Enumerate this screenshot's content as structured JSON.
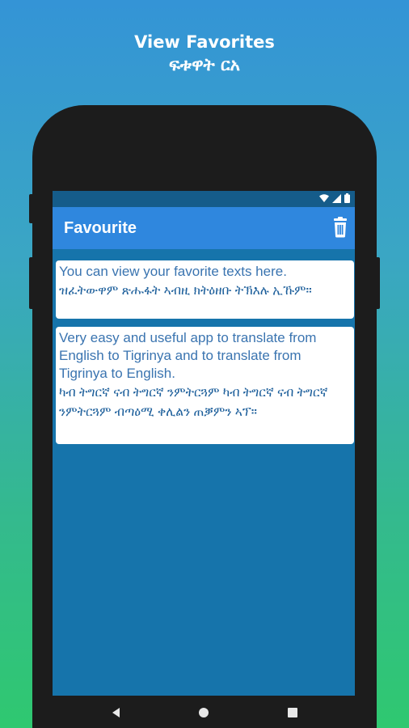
{
  "promo": {
    "title_en": "View Favorites",
    "title_ti": "ፍቱዋት ርአ"
  },
  "app": {
    "title": "Favourite",
    "colors": {
      "appbar": "#2f87de",
      "screen_bg": "#1674ab",
      "card_bg": "#ffffff",
      "text": "#2a6fa8"
    }
  },
  "favorites": [
    {
      "english": "You can view your favorite texts here.",
      "tigrinya": "ዝፈትውዋም ጽሑፋት ኣብዚ ክትዕዘቡ ትኽእሉ ኢኹም።"
    },
    {
      "english": "Very easy and useful app to translate from English to Tigrinya and to translate from Tigrinya to English.",
      "tigrinya": "ካብ ትግርኛ ናብ ትግርኛ ንምትርጓም ካብ ትግርኛ ናብ ትግርኛ ንምትርጓም ብጣዕሚ ቀሊልን ጠቓምን ኣፕ።"
    }
  ],
  "icons": {
    "delete": "trash-icon",
    "wifi": "wifi-icon",
    "signal": "signal-icon",
    "battery": "battery-icon",
    "back": "back-icon",
    "home": "home-icon",
    "recent": "recent-apps-icon"
  }
}
